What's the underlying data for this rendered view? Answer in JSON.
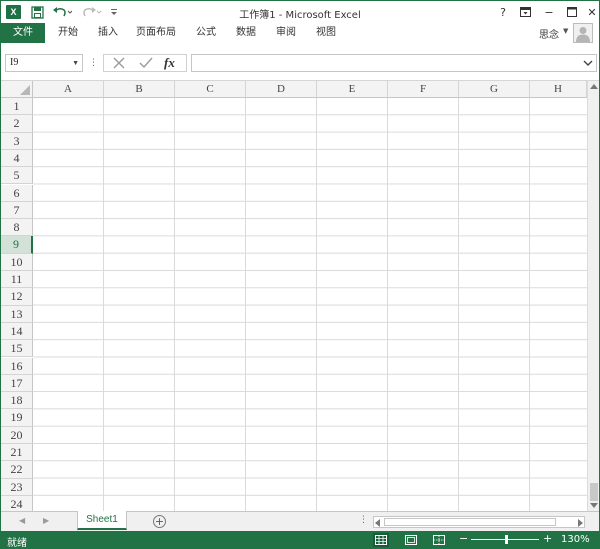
{
  "window": {
    "title": "工作簿1 - Microsoft Excel",
    "app_logo_letter": "X"
  },
  "title_buttons": {
    "help": "?",
    "minimize": "−",
    "close": "✕"
  },
  "ribbon": {
    "file_tab": "文件",
    "tabs": [
      "开始",
      "插入",
      "页面布局",
      "公式",
      "数据",
      "审阅",
      "视图"
    ],
    "user_name": "思念"
  },
  "formula_bar": {
    "name_box": "I9",
    "fx_label": "fx",
    "formula_value": ""
  },
  "grid": {
    "columns": [
      "A",
      "B",
      "C",
      "D",
      "E",
      "F",
      "G",
      "H"
    ],
    "rows": [
      "1",
      "2",
      "3",
      "4",
      "5",
      "6",
      "7",
      "8",
      "9",
      "10",
      "11",
      "12",
      "13",
      "14",
      "15",
      "16",
      "17",
      "18",
      "19",
      "20",
      "21",
      "22",
      "23",
      "24"
    ],
    "active_row": "9"
  },
  "sheets": {
    "tabs": [
      "Sheet1"
    ],
    "active": "Sheet1",
    "add_symbol": "+"
  },
  "status": {
    "ready_text": "就绪",
    "zoom_level": "130%",
    "zoom_minus": "−",
    "zoom_plus": "+"
  },
  "colors": {
    "accent": "#217346",
    "grid_line": "#dadada",
    "header_bg": "#f3f3f3"
  }
}
